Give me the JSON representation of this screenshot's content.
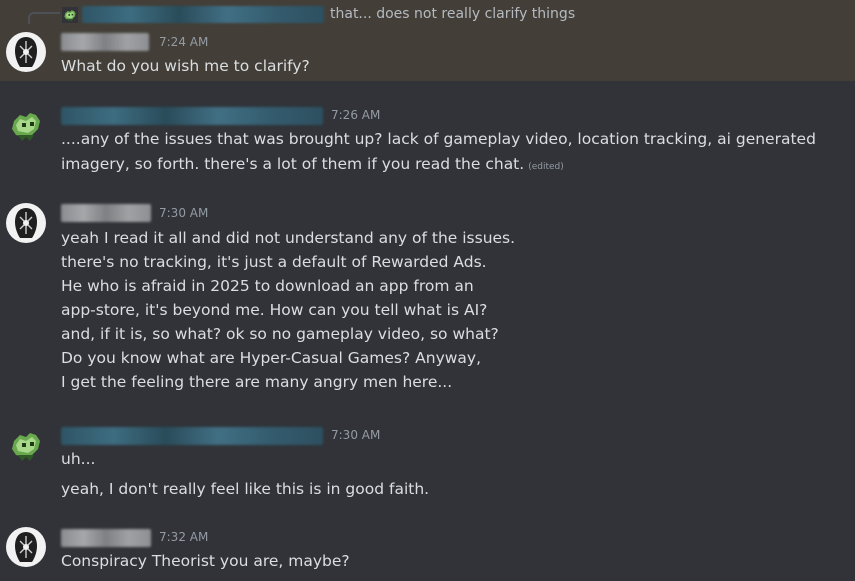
{
  "reply": {
    "text": "that... does not really clarify things"
  },
  "messages": [
    {
      "time": "7:24 AM",
      "lines": [
        "What do you wish me to clarify?"
      ]
    },
    {
      "time": "7:26 AM",
      "lines": [
        "....any of the issues that was brought up? lack of gameplay video, location tracking, ai generated",
        "imagery, so forth. there's a lot of them if you read the chat."
      ],
      "edited": "(edited)"
    },
    {
      "time": "7:30 AM",
      "lines": [
        "yeah I read it all and did not understand any of the issues.",
        "there's no tracking, it's just a default of Rewarded Ads.",
        "He who is afraid in 2025 to download an app from an",
        "app-store, it's beyond me. How can you tell what is AI?",
        "and, if it is, so what? ok so no gameplay video, so what?",
        "Do you know what are Hyper-Casual Games? Anyway,",
        "I get the feeling there are many angry men here..."
      ]
    },
    {
      "time": "7:30 AM",
      "lines": [
        "uh...",
        "yeah, I don't really feel like this is in good faith."
      ]
    },
    {
      "time": "7:32 AM",
      "lines": [
        "Conspiracy Theorist you are, maybe?"
      ]
    }
  ],
  "icons": {
    "user_a": "hooded-figure-avatar",
    "user_b": "green-pixel-creature-avatar"
  }
}
